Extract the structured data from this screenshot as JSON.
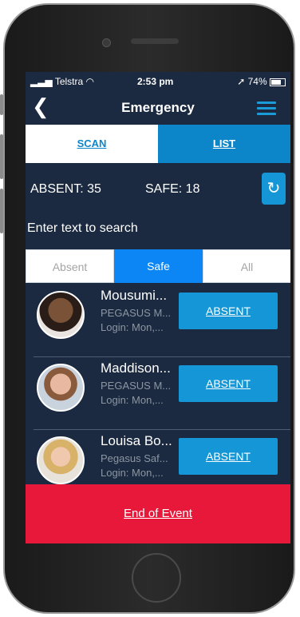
{
  "status_bar": {
    "carrier": "Telstra",
    "time": "2:53 pm",
    "battery": "74%"
  },
  "header": {
    "title": "Emergency",
    "back_icon": "chevron-left-icon",
    "menu_icon": "hamburger-menu-icon"
  },
  "view_tabs": {
    "scan": "SCAN",
    "list": "LIST",
    "active": "list"
  },
  "counts": {
    "absent": "ABSENT: 35",
    "safe": "SAFE: 18"
  },
  "refresh_icon": "refresh-icon",
  "search": {
    "placeholder": "Enter text to search",
    "value": ""
  },
  "filters": {
    "absent": "Absent",
    "safe": "Safe",
    "all": "All",
    "selected": "Safe"
  },
  "people": [
    {
      "name": "Mousumi...",
      "org": "PEGASUS M...",
      "login": "Login: Mon,...",
      "action": "ABSENT"
    },
    {
      "name": "Maddison...",
      "org": "PEGASUS M...",
      "login": "Login: Mon,...",
      "action": "ABSENT"
    },
    {
      "name": "Louisa Bo...",
      "org": "Pegasus Saf...",
      "login": "Login: Mon,...",
      "action": "ABSENT"
    }
  ],
  "footer": {
    "label": "End of Event"
  },
  "colors": {
    "background": "#1b2a40",
    "accent": "#1596d6",
    "danger": "#e8183a"
  }
}
